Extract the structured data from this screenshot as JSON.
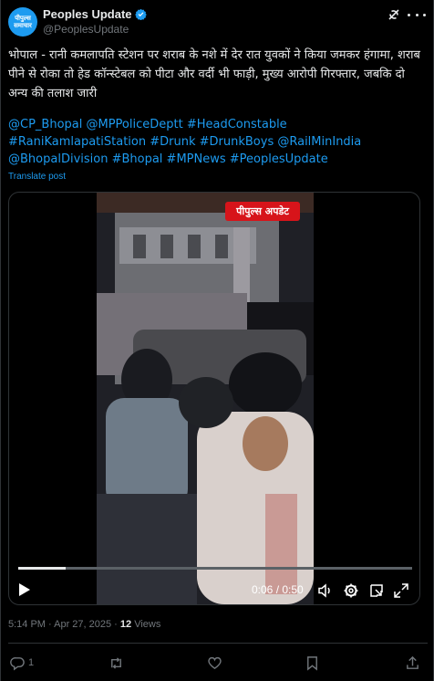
{
  "author": {
    "display_name": "Peoples Update",
    "handle": "@PeoplesUpdate",
    "avatar_text_line1": "पीपुल्स",
    "avatar_text_line2": "समाचार",
    "verified": true
  },
  "post": {
    "text": "भोपाल - रानी कमलापति स्टेशन पर शराब के नशे में देर रात युवकों ने किया जमकर हंगामा, शराब पीने से रोका तो हेड कॉन्स्टेबल को पीटा और वर्दी भी फाड़ी, मुख्य आरोपी गिरफ्तार, जबकि दो अन्य की तलाश जारी",
    "hashtags": "@CP_Bhopal @MPPoliceDeptt #HeadConstable #RaniKamlapatiStation #Drunk #DrunkBoys @RailMinIndia @BhopalDivision #Bhopal #MPNews #PeoplesUpdate",
    "translate_label": "Translate post"
  },
  "video": {
    "overlay_logo": "पीपुल्स अपडेट",
    "time_display": "0:06 / 0:50",
    "progress_fraction": 0.12
  },
  "meta": {
    "timestamp": "5:14 PM · Apr 27, 2025 · ",
    "views_count": "12",
    "views_label": " Views"
  },
  "actions": {
    "reply_count": "1",
    "repost_count": "",
    "like_count": ""
  },
  "colors": {
    "background": "#000000",
    "link": "#1d9bf0",
    "muted": "#71767b",
    "text": "#e7e9ea"
  }
}
